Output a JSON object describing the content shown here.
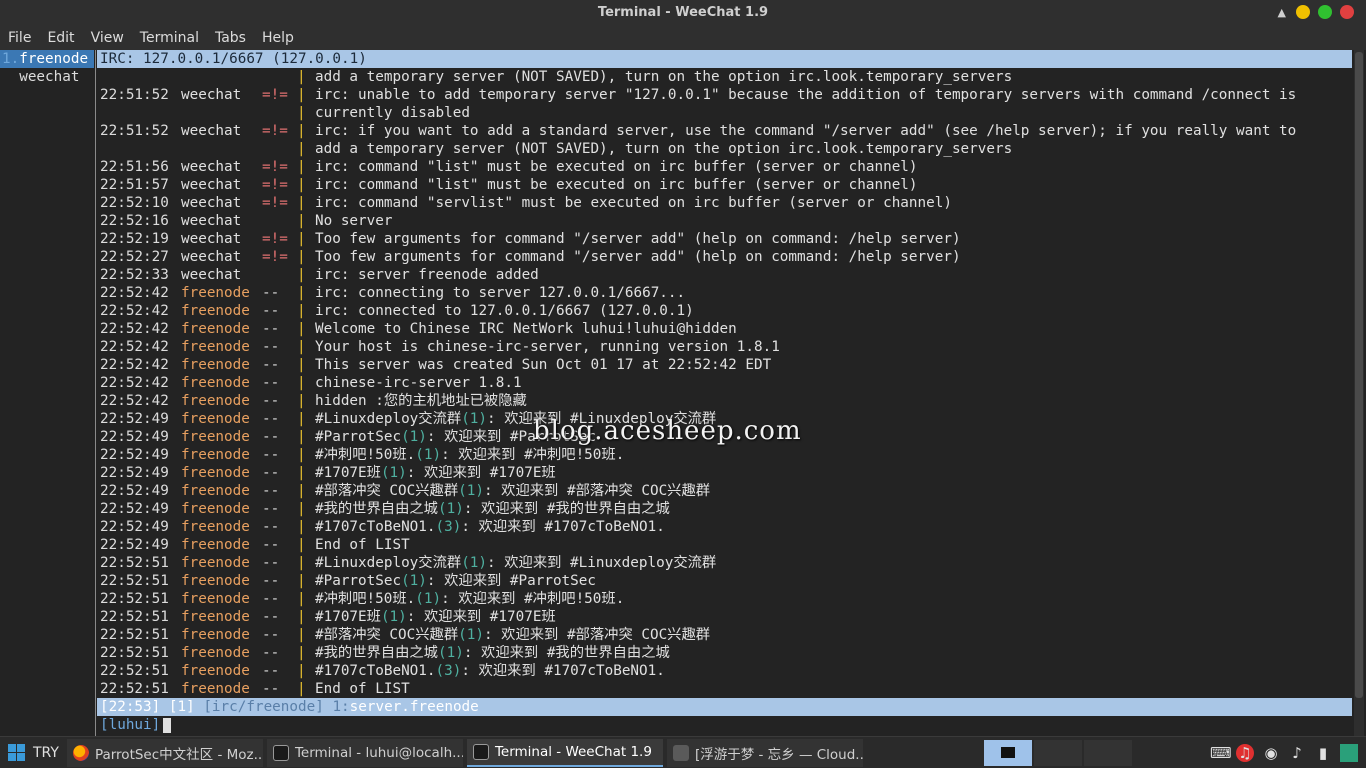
{
  "window": {
    "title": "Terminal - WeeChat 1.9",
    "shade_icon": "▲",
    "controls": {
      "minimize_color": "#f0c000",
      "maximize_color": "#30c030",
      "close_color": "#e04040"
    }
  },
  "menu": [
    "File",
    "Edit",
    "View",
    "Terminal",
    "Tabs",
    "Help"
  ],
  "buflist": [
    {
      "num": "1.",
      "name": "freenode",
      "active": true
    },
    {
      "num": "",
      "name": "weechat",
      "active": false
    }
  ],
  "title_line": "IRC: 127.0.0.1/6667 (127.0.0.1)",
  "lines": [
    {
      "time": "",
      "nick": "",
      "nick_type": "",
      "prefix": "",
      "err": false,
      "msg": "add a temporary server (NOT SAVED), turn on the option irc.look.temporary_servers"
    },
    {
      "time": "22:51:52",
      "nick": "weechat",
      "nick_type": "weechat",
      "prefix": "=!=",
      "err": true,
      "msg": "irc: unable to add temporary server \"127.0.0.1\" because the addition of temporary servers with command /connect is"
    },
    {
      "time": "",
      "nick": "",
      "nick_type": "",
      "prefix": "",
      "err": false,
      "msg": "currently disabled"
    },
    {
      "time": "22:51:52",
      "nick": "weechat",
      "nick_type": "weechat",
      "prefix": "=!=",
      "err": true,
      "msg": "irc: if you want to add a standard server, use the command \"/server add\" (see /help server); if you really want to"
    },
    {
      "time": "",
      "nick": "",
      "nick_type": "",
      "prefix": "",
      "err": false,
      "msg": "add a temporary server (NOT SAVED), turn on the option irc.look.temporary_servers"
    },
    {
      "time": "22:51:56",
      "nick": "weechat",
      "nick_type": "weechat",
      "prefix": "=!=",
      "err": true,
      "msg": "irc: command \"list\" must be executed on irc buffer (server or channel)"
    },
    {
      "time": "22:51:57",
      "nick": "weechat",
      "nick_type": "weechat",
      "prefix": "=!=",
      "err": true,
      "msg": "irc: command \"list\" must be executed on irc buffer (server or channel)"
    },
    {
      "time": "22:52:10",
      "nick": "weechat",
      "nick_type": "weechat",
      "prefix": "=!=",
      "err": true,
      "msg": "irc: command \"servlist\" must be executed on irc buffer (server or channel)"
    },
    {
      "time": "22:52:16",
      "nick": "weechat",
      "nick_type": "weechat",
      "prefix": "",
      "err": false,
      "msg": "No server"
    },
    {
      "time": "22:52:19",
      "nick": "weechat",
      "nick_type": "weechat",
      "prefix": "=!=",
      "err": true,
      "msg": "Too few arguments for command \"/server add\" (help on command: /help server)"
    },
    {
      "time": "22:52:27",
      "nick": "weechat",
      "nick_type": "weechat",
      "prefix": "=!=",
      "err": true,
      "msg": "Too few arguments for command \"/server add\" (help on command: /help server)"
    },
    {
      "time": "22:52:33",
      "nick": "weechat",
      "nick_type": "weechat",
      "prefix": "",
      "err": false,
      "msg": "irc: server freenode added"
    },
    {
      "time": "22:52:42",
      "nick": "freenode",
      "nick_type": "freenode",
      "prefix": "--",
      "err": false,
      "msg": "irc: connecting to server 127.0.0.1/6667..."
    },
    {
      "time": "22:52:42",
      "nick": "freenode",
      "nick_type": "freenode",
      "prefix": "--",
      "err": false,
      "msg": "irc: connected to 127.0.0.1/6667 (127.0.0.1)"
    },
    {
      "time": "22:52:42",
      "nick": "freenode",
      "nick_type": "freenode",
      "prefix": "--",
      "err": false,
      "msg": "Welcome to Chinese IRC NetWork luhui!luhui@hidden"
    },
    {
      "time": "22:52:42",
      "nick": "freenode",
      "nick_type": "freenode",
      "prefix": "--",
      "err": false,
      "msg": "Your host is chinese-irc-server, running version 1.8.1"
    },
    {
      "time": "22:52:42",
      "nick": "freenode",
      "nick_type": "freenode",
      "prefix": "--",
      "err": false,
      "msg": "This server was created Sun Oct 01 17 at 22:52:42 EDT"
    },
    {
      "time": "22:52:42",
      "nick": "freenode",
      "nick_type": "freenode",
      "prefix": "--",
      "err": false,
      "msg": "chinese-irc-server 1.8.1"
    },
    {
      "time": "22:52:42",
      "nick": "freenode",
      "nick_type": "freenode",
      "prefix": "--",
      "err": false,
      "msg": "hidden :您的主机地址已被隐藏"
    },
    {
      "time": "22:52:49",
      "nick": "freenode",
      "nick_type": "freenode",
      "prefix": "--",
      "err": false,
      "msg": "#Linuxdeploy交流群",
      "count": "(1)",
      "tail": ": 欢迎来到 #Linuxdeploy交流群"
    },
    {
      "time": "22:52:49",
      "nick": "freenode",
      "nick_type": "freenode",
      "prefix": "--",
      "err": false,
      "msg": "#ParrotSec",
      "count": "(1)",
      "tail": ": 欢迎来到 #ParrotSec"
    },
    {
      "time": "22:52:49",
      "nick": "freenode",
      "nick_type": "freenode",
      "prefix": "--",
      "err": false,
      "msg": "#冲刺吧!50班.",
      "count": "(1)",
      "tail": ": 欢迎来到 #冲刺吧!50班."
    },
    {
      "time": "22:52:49",
      "nick": "freenode",
      "nick_type": "freenode",
      "prefix": "--",
      "err": false,
      "msg": "#1707E班",
      "count": "(1)",
      "tail": ": 欢迎来到 #1707E班"
    },
    {
      "time": "22:52:49",
      "nick": "freenode",
      "nick_type": "freenode",
      "prefix": "--",
      "err": false,
      "msg": "#部落冲突 COC兴趣群",
      "count": "(1)",
      "tail": ": 欢迎来到 #部落冲突 COC兴趣群"
    },
    {
      "time": "22:52:49",
      "nick": "freenode",
      "nick_type": "freenode",
      "prefix": "--",
      "err": false,
      "msg": "#我的世界自由之城",
      "count": "(1)",
      "tail": ": 欢迎来到 #我的世界自由之城"
    },
    {
      "time": "22:52:49",
      "nick": "freenode",
      "nick_type": "freenode",
      "prefix": "--",
      "err": false,
      "msg": "#1707cToBeNO1.",
      "count": "(3)",
      "tail": ": 欢迎来到 #1707cToBeNO1."
    },
    {
      "time": "22:52:49",
      "nick": "freenode",
      "nick_type": "freenode",
      "prefix": "--",
      "err": false,
      "msg": "End of LIST"
    },
    {
      "time": "22:52:51",
      "nick": "freenode",
      "nick_type": "freenode",
      "prefix": "--",
      "err": false,
      "msg": "#Linuxdeploy交流群",
      "count": "(1)",
      "tail": ": 欢迎来到 #Linuxdeploy交流群"
    },
    {
      "time": "22:52:51",
      "nick": "freenode",
      "nick_type": "freenode",
      "prefix": "--",
      "err": false,
      "msg": "#ParrotSec",
      "count": "(1)",
      "tail": ": 欢迎来到 #ParrotSec"
    },
    {
      "time": "22:52:51",
      "nick": "freenode",
      "nick_type": "freenode",
      "prefix": "--",
      "err": false,
      "msg": "#冲刺吧!50班.",
      "count": "(1)",
      "tail": ": 欢迎来到 #冲刺吧!50班."
    },
    {
      "time": "22:52:51",
      "nick": "freenode",
      "nick_type": "freenode",
      "prefix": "--",
      "err": false,
      "msg": "#1707E班",
      "count": "(1)",
      "tail": ": 欢迎来到 #1707E班"
    },
    {
      "time": "22:52:51",
      "nick": "freenode",
      "nick_type": "freenode",
      "prefix": "--",
      "err": false,
      "msg": "#部落冲突 COC兴趣群",
      "count": "(1)",
      "tail": ": 欢迎来到 #部落冲突 COC兴趣群"
    },
    {
      "time": "22:52:51",
      "nick": "freenode",
      "nick_type": "freenode",
      "prefix": "--",
      "err": false,
      "msg": "#我的世界自由之城",
      "count": "(1)",
      "tail": ": 欢迎来到 #我的世界自由之城"
    },
    {
      "time": "22:52:51",
      "nick": "freenode",
      "nick_type": "freenode",
      "prefix": "--",
      "err": false,
      "msg": "#1707cToBeNO1.",
      "count": "(3)",
      "tail": ": 欢迎来到 #1707cToBeNO1."
    },
    {
      "time": "22:52:51",
      "nick": "freenode",
      "nick_type": "freenode",
      "prefix": "--",
      "err": false,
      "msg": "End of LIST"
    }
  ],
  "status": {
    "time": "[22:53]",
    "buffer_num": "[1]",
    "plugin": "[irc/freenode]",
    "buffer_index": "1:",
    "buffer_name": "server.freenode"
  },
  "input": {
    "nick": "[luhui]",
    "value": ""
  },
  "watermark": "blog.acesheep.com",
  "taskbar": {
    "start_label": "TRY",
    "tasks": [
      {
        "label": "ParrotSec中文社区 - Moz...",
        "icon": "firefox-icon",
        "active": false
      },
      {
        "label": "Terminal - luhui@localh...",
        "icon": "terminal-icon",
        "active": false
      },
      {
        "label": "Terminal - WeeChat 1.9",
        "icon": "terminal-icon",
        "active": true
      },
      {
        "label": "[浮游于梦 - 忘乡 — Cloud...",
        "icon": "cloud-music-icon",
        "active": false
      }
    ],
    "tray": [
      "keyboard-icon",
      "netease-music-icon",
      "wifi-icon",
      "volume-icon",
      "battery-icon",
      "show-desktop-icon"
    ]
  }
}
